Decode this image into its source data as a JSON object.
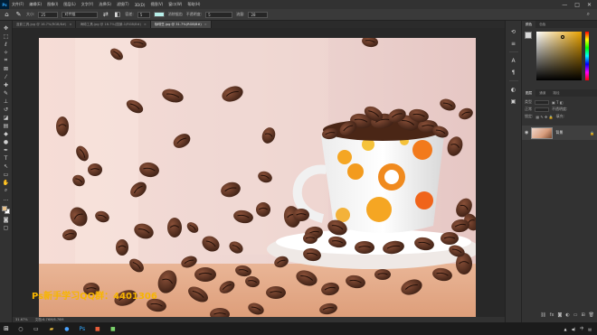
{
  "menubar": {
    "logo": "Ps",
    "items": [
      "文件(F)",
      "编辑(E)",
      "图像(I)",
      "图层(L)",
      "文字(Y)",
      "选择(S)",
      "滤镜(T)",
      "3D(D)",
      "视图(V)",
      "窗口(W)",
      "帮助(H)"
    ],
    "window_controls": [
      "—",
      "□",
      "✕"
    ]
  },
  "optionsbar": {
    "size_label": "大小:",
    "size_value": "25",
    "mode_value": "对齐链",
    "tolerance_label": "容差:",
    "tolerance_value": "5",
    "antialias_label": "消除锯齿",
    "opacity_label": "不透明度:",
    "opacity_value": "5",
    "flow_label": "流量:",
    "flow_value": "28",
    "swatch_color": "#b7efe9"
  },
  "tabs": [
    {
      "label": "蓝影工具.jpg @ 16.7%(RGB/8#)",
      "active": false
    },
    {
      "label": "海绵工具.jpg @ 16.7%(国景-1/RGB/8#)",
      "active": false
    },
    {
      "label": "咖啡豆.jpg @ 31.7%(RGB/8#)",
      "active": true
    }
  ],
  "watermark": "Ps新手学习QQ群：4401306",
  "statusbar": {
    "zoom": "31.67%",
    "doc_info": "文档:6.76M/6.76M"
  },
  "color_panel": {
    "tabs": [
      "颜色",
      "色板"
    ]
  },
  "layers_panel": {
    "tabs": [
      "图层",
      "通道",
      "路径"
    ],
    "kind_label": "类型",
    "mode_label": "正常",
    "opacity_label": "不透明度:",
    "lock_label": "锁定:",
    "fill_label": "填充:",
    "layer_name": "背景"
  },
  "colors": {
    "watermark": "#f7b500",
    "accent_orange": "#f08a1e"
  }
}
